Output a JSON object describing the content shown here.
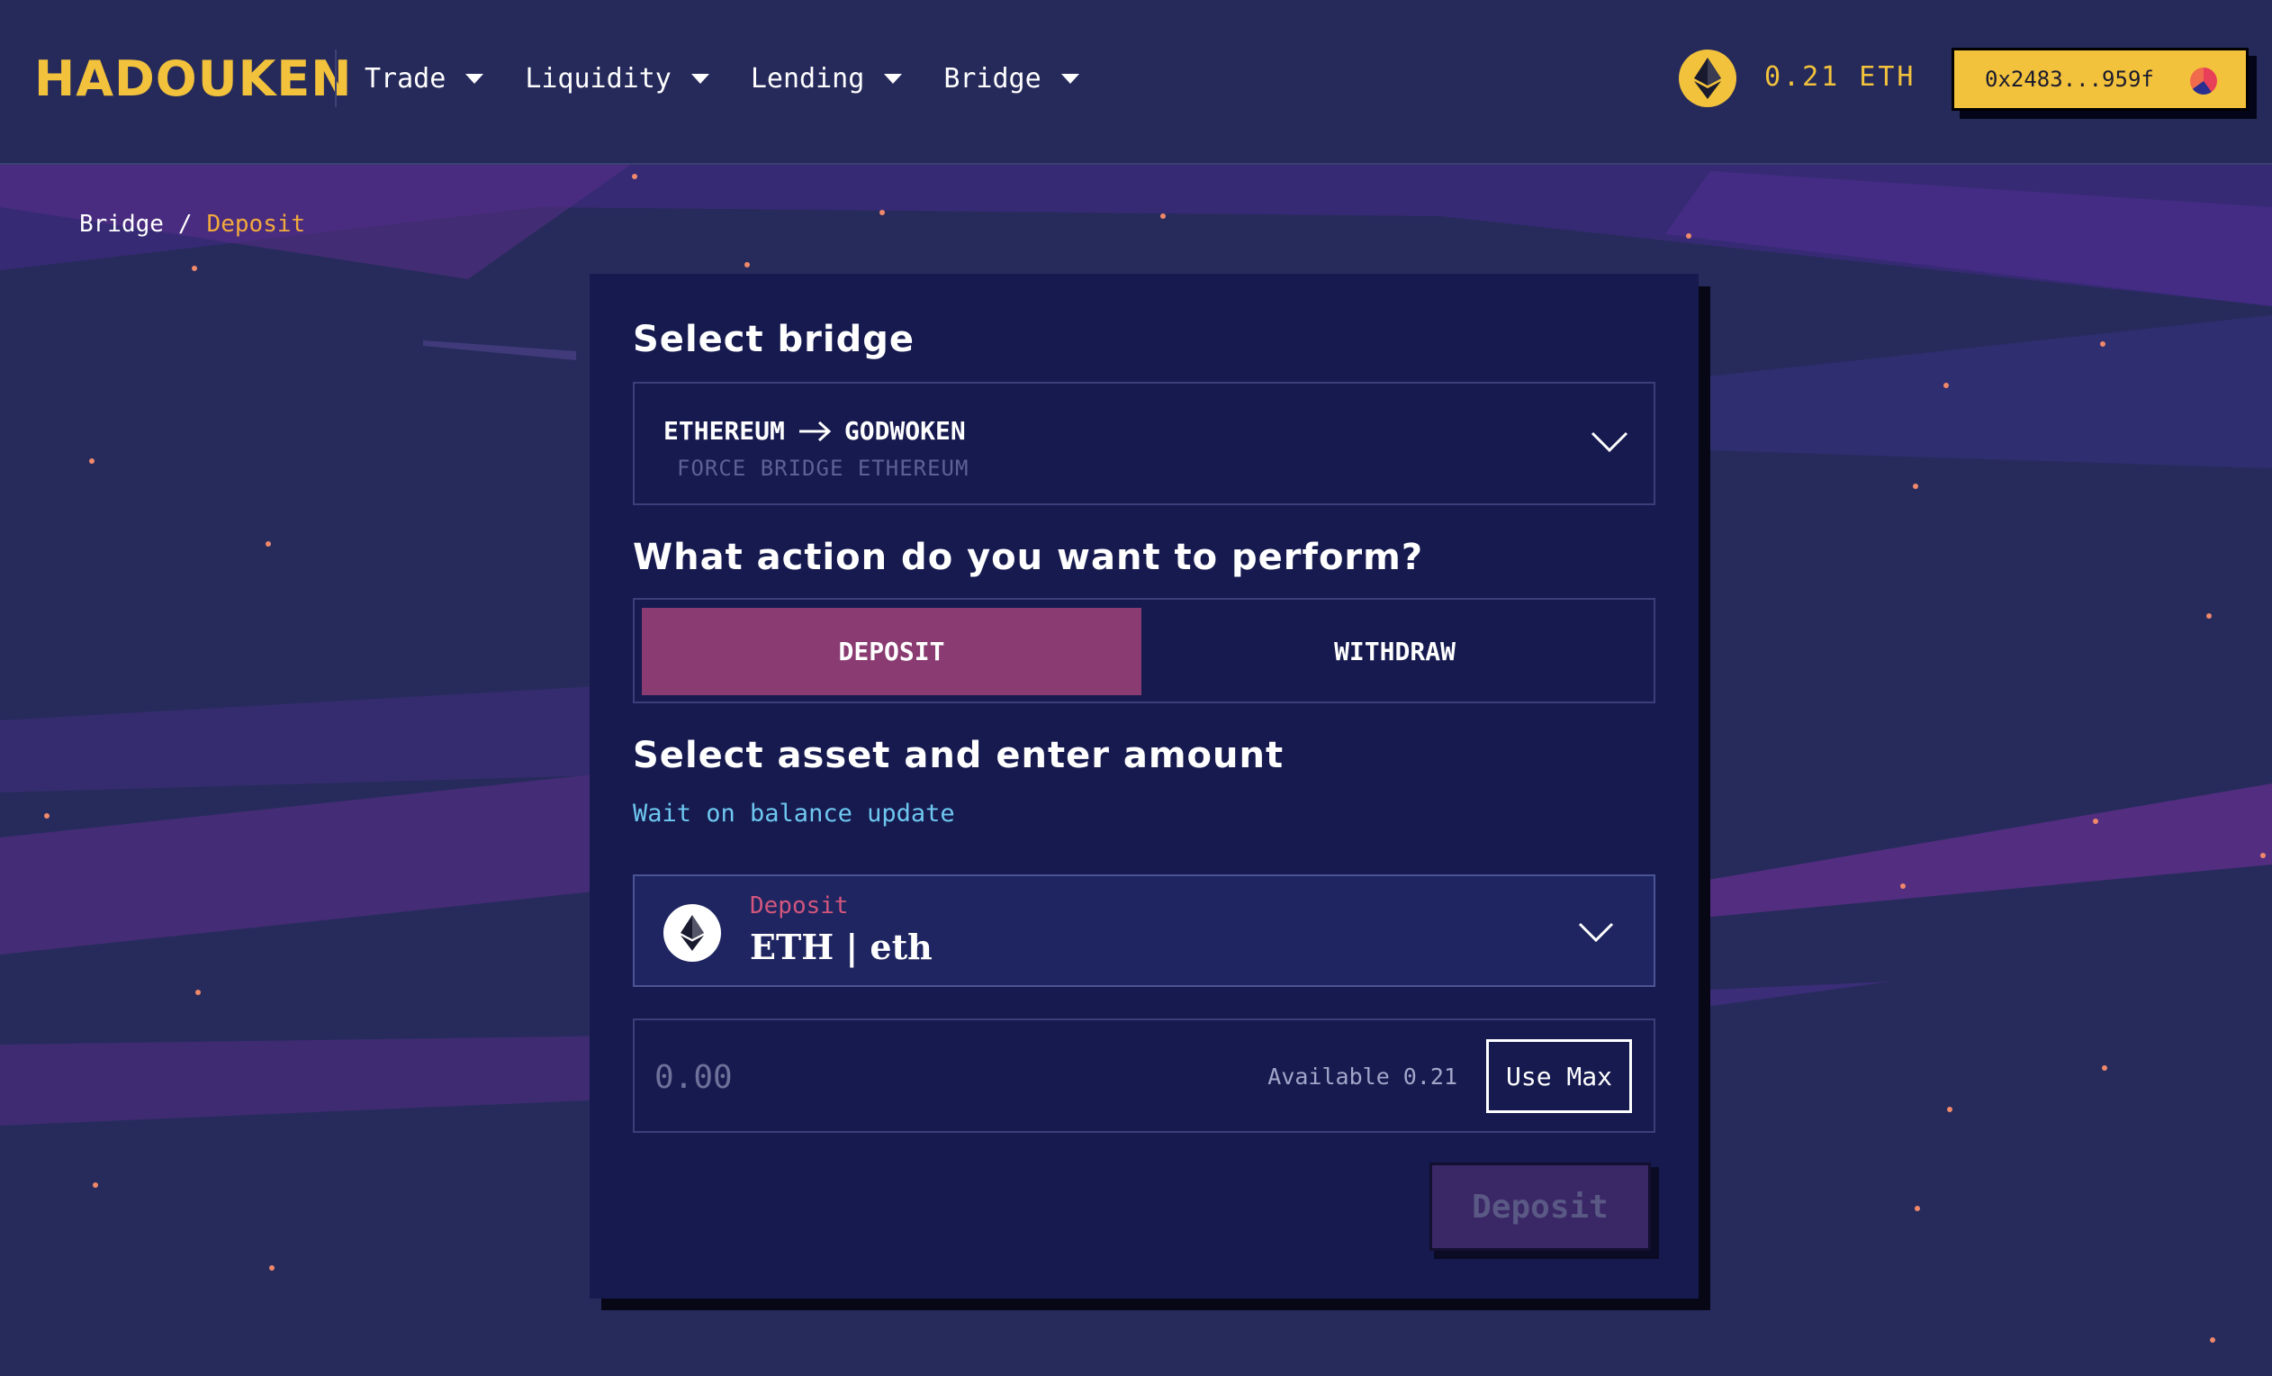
{
  "header": {
    "logo_text": "HADOUKEN",
    "nav": [
      {
        "label": "Trade"
      },
      {
        "label": "Liquidity"
      },
      {
        "label": "Lending"
      },
      {
        "label": "Bridge"
      }
    ],
    "eth_balance": "0.21 ETH",
    "wallet_address": "0x2483...959f"
  },
  "breadcrumb": {
    "root": "Bridge",
    "separator": "/",
    "current": "Deposit"
  },
  "bridge": {
    "title": "Select bridge",
    "from": "ETHEREUM",
    "to": "GODWOKEN",
    "provider": "FORCE BRIDGE ETHEREUM"
  },
  "action": {
    "title": "What action do you want to perform?",
    "deposit_label": "DEPOSIT",
    "withdraw_label": "WITHDRAW",
    "selected": "DEPOSIT"
  },
  "asset": {
    "title": "Select asset and enter amount",
    "status": "Wait on balance update",
    "field_label": "Deposit",
    "selected": "ETH | eth"
  },
  "amount": {
    "placeholder": "0.00",
    "available": "Available 0.21",
    "use_max_label": "Use Max"
  },
  "submit": {
    "label": "Deposit"
  },
  "colors": {
    "accent_yellow": "#f2c23c",
    "deposit_active": "#8a3c72",
    "card_bg": "#161a4f",
    "page_bg": "#272b5c",
    "status_blue": "#6ec8f0",
    "label_pink": "#d2567e",
    "breadcrumb_orange": "#f2a93c"
  }
}
